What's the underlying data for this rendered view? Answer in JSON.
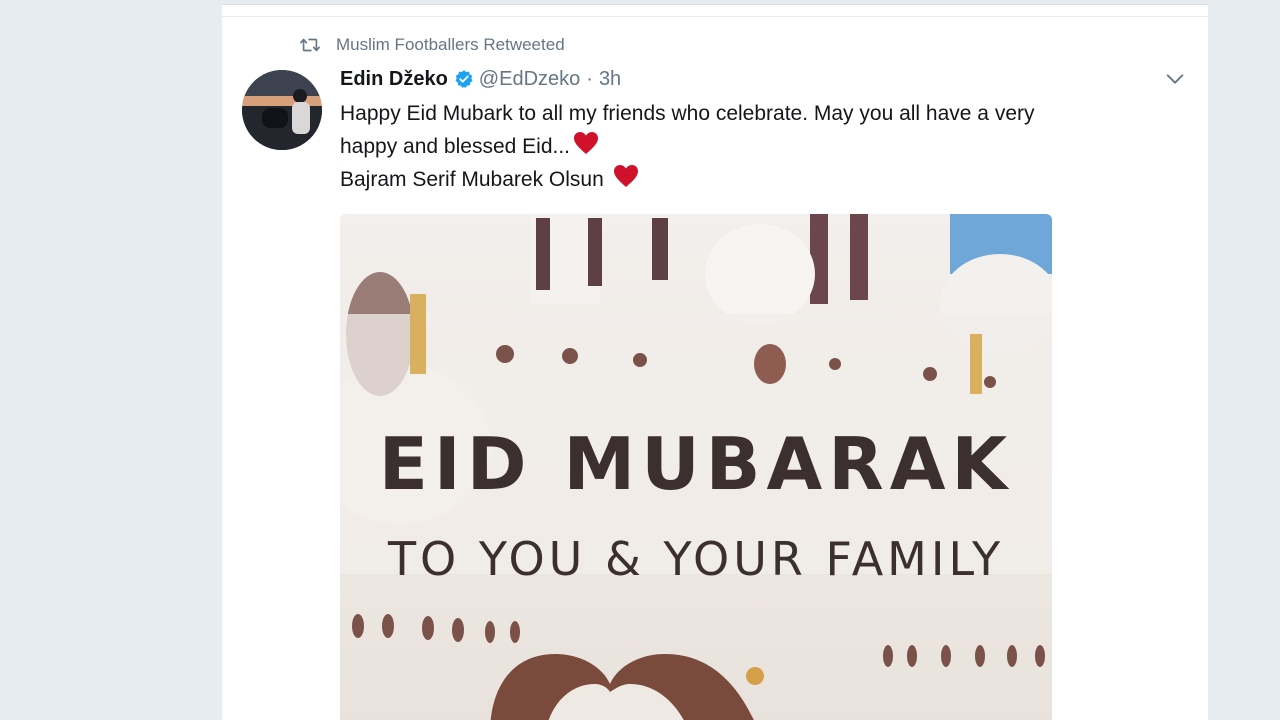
{
  "colors": {
    "background": "#e6ecf0",
    "card": "#ffffff",
    "text_primary": "#14171a",
    "text_secondary": "#657786",
    "verified_blue": "#1da1f2",
    "heart_red": "#e0245e",
    "image_text": "#3b2f2f"
  },
  "retweet_context": {
    "icon": "retweet-icon",
    "text": "Muslim Footballers Retweeted"
  },
  "tweet": {
    "display_name": "Edin Džeko",
    "verified_icon": "verified-badge-icon",
    "handle": "@EdDzeko",
    "separator": "·",
    "time": "3h",
    "menu_icon": "chevron-down-icon",
    "text_lines": [
      "Happy Eid Mubark to all my friends who celebrate. May you all have a very",
      "happy and blessed Eid...",
      "Bajram Serif Mubarek Olsun"
    ],
    "emoji": "heart-icon"
  },
  "media": {
    "title": "EID MUBARAK",
    "subtitle": "TO YOU & YOUR FAMILY"
  }
}
